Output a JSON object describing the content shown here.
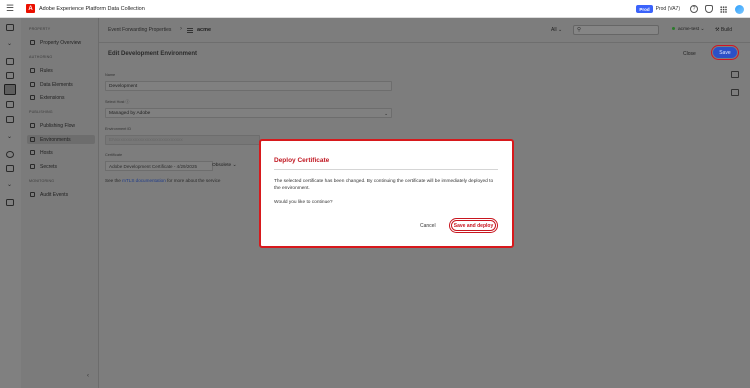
{
  "app": {
    "title": "Adobe Experience Platform Data Collection",
    "logo_letter": "A"
  },
  "header": {
    "env_badge": "Prod",
    "env_label": "Prod (VA7)"
  },
  "subnav": {
    "sections": {
      "property": "PROPERTY",
      "authoring": "AUTHORING",
      "publishing": "PUBLISHING",
      "monitoring": "MONITORING"
    },
    "items": {
      "property_overview": "Property Overview",
      "rules": "Rules",
      "data_elements": "Data Elements",
      "extensions": "Extensions",
      "publishing_flow": "Publishing Flow",
      "environments": "Environments",
      "hosts": "Hosts",
      "secrets": "Secrets",
      "audit_events": "Audit Events"
    }
  },
  "toolbar": {
    "breadcrumb": "Event Forwarding Properties",
    "current_property": "acme",
    "filter": "All",
    "library": "acme-test",
    "build": "Build"
  },
  "page": {
    "title": "Edit Development Environment",
    "close_label": "Close",
    "save_label": "Save",
    "name_label": "Name",
    "name_value": "Development",
    "host_label": "Select Host",
    "host_value": "Managed by Adobe",
    "env_id_label": "Environment ID",
    "env_id_value": "ENxxxxxxxxxxxxxxxxxxxxxxxxxxxx",
    "cert_label": "Certificate",
    "cert_value": "Adobe Development Certificate - 4/29/2025",
    "cert_status": "Obsolete",
    "help_prefix": "See the",
    "help_link": "mTLS documentation",
    "help_suffix": "for more about the service"
  },
  "dialog": {
    "title": "Deploy Certificate",
    "body": "The selected certificate has been changed. By continuing the certificate will be immediately deployed to the environment.",
    "question": "Would you like to continue?",
    "cancel_label": "Cancel",
    "confirm_label": "Save and deploy"
  },
  "colors": {
    "accent": "#2c50c7",
    "highlight": "#d7191c",
    "brand": "#eb1000"
  }
}
